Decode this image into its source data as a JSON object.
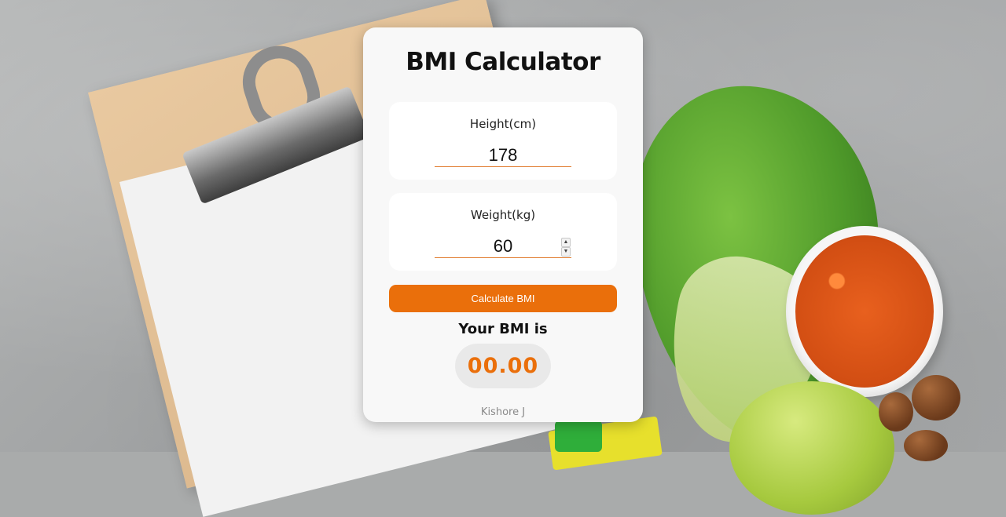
{
  "calculator": {
    "title": "BMI Calculator",
    "height": {
      "label": "Height(cm)",
      "value": "178"
    },
    "weight": {
      "label": "Weight(kg)",
      "value": "60"
    },
    "calculate_label": "Calculate BMI",
    "result_label": "Your BMI is",
    "result_value": "00.00",
    "author": "Kishore J"
  },
  "colors": {
    "accent": "#ea6f0b",
    "card_background": "#f8f8f8",
    "result_pill": "#e9e9e9"
  },
  "icons": {
    "spinner_up": "caret-up-icon",
    "spinner_down": "caret-down-icon"
  }
}
